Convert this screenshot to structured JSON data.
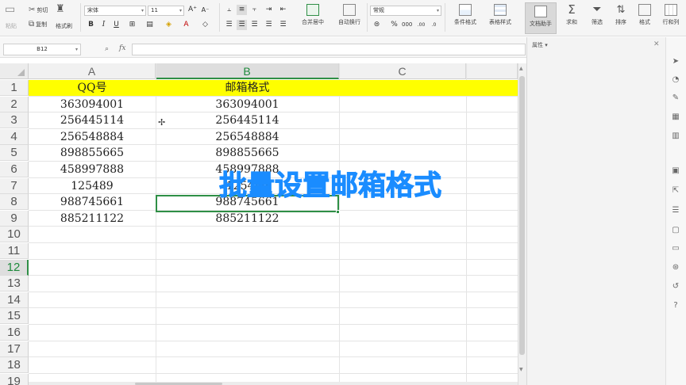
{
  "ribbon": {
    "paste_label": "粘贴",
    "cut_label": "剪切",
    "copy_label": "复制",
    "format_painter_label": "格式刷",
    "font_name": "宋体",
    "font_size": "11",
    "bold_label": "B",
    "italic_label": "I",
    "underline_label": "U",
    "merge_center_label": "合并居中",
    "wrap_text_label": "自动换行",
    "number_format": "常规",
    "percent_label": "%",
    "conditional_format_label": "条件格式",
    "table_style_label": "表格样式",
    "doc_helper_label": "文档助手",
    "sum_label": "求和",
    "filter_label": "筛选",
    "sort_label": "排序",
    "format_label": "格式",
    "row_col_label": "行和列"
  },
  "formula_bar": {
    "cell_reference": "B12",
    "fx_label": "fx",
    "formula": ""
  },
  "task_pane": {
    "title": "属性"
  },
  "sheet": {
    "columns": [
      "A",
      "B",
      "C"
    ],
    "selected_column": "B",
    "row_numbers": [
      "1",
      "2",
      "3",
      "4",
      "5",
      "6",
      "7",
      "8",
      "9",
      "10",
      "11",
      "12",
      "13",
      "14",
      "15",
      "16",
      "17",
      "18",
      "19"
    ],
    "selected_row": "12",
    "selected_cell": "B12",
    "header_fill_color": "#ffff00",
    "rows": [
      {
        "a": "QQ号",
        "b": "邮箱格式"
      },
      {
        "a": "363094001",
        "b": "363094001"
      },
      {
        "a": "256445114",
        "b": "256445114"
      },
      {
        "a": "256548884",
        "b": "256548884"
      },
      {
        "a": "898855665",
        "b": "898855665"
      },
      {
        "a": "458997888",
        "b": "458997888"
      },
      {
        "a": "125489",
        "b": "125489"
      },
      {
        "a": "988745661",
        "b": "988745661"
      },
      {
        "a": "885211122",
        "b": "885211122"
      }
    ]
  },
  "overlay": {
    "caption": "批量设置邮箱格式",
    "caption_color": "#1a8cff"
  },
  "colors": {
    "selection_green": "#2f8f46",
    "header_yellow": "#ffff00"
  }
}
